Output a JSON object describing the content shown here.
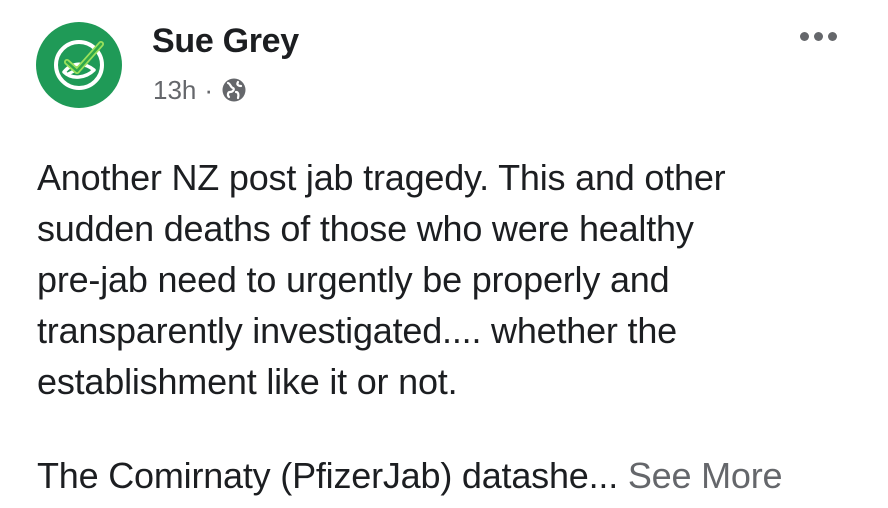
{
  "post": {
    "author": "Sue Grey",
    "time": "13h",
    "separator": "·",
    "privacy_icon": "globe-icon",
    "menu_icon": "more-options-icon",
    "avatar_icon": "checkmark-leaf-logo-icon",
    "body_lines": [
      "Another NZ post jab tragedy. This and other",
      "sudden deaths of those who were healthy",
      "pre-jab need to urgently be properly and",
      "transparently investigated.... whether the",
      "establishment like it or not."
    ],
    "second_paragraph": "The Comirnaty (PfizerJab) datashe...",
    "see_more": "See More"
  },
  "colors": {
    "avatar_bg": "#1f9a57",
    "text": "#1c1e21",
    "secondary_text": "#65676b"
  }
}
